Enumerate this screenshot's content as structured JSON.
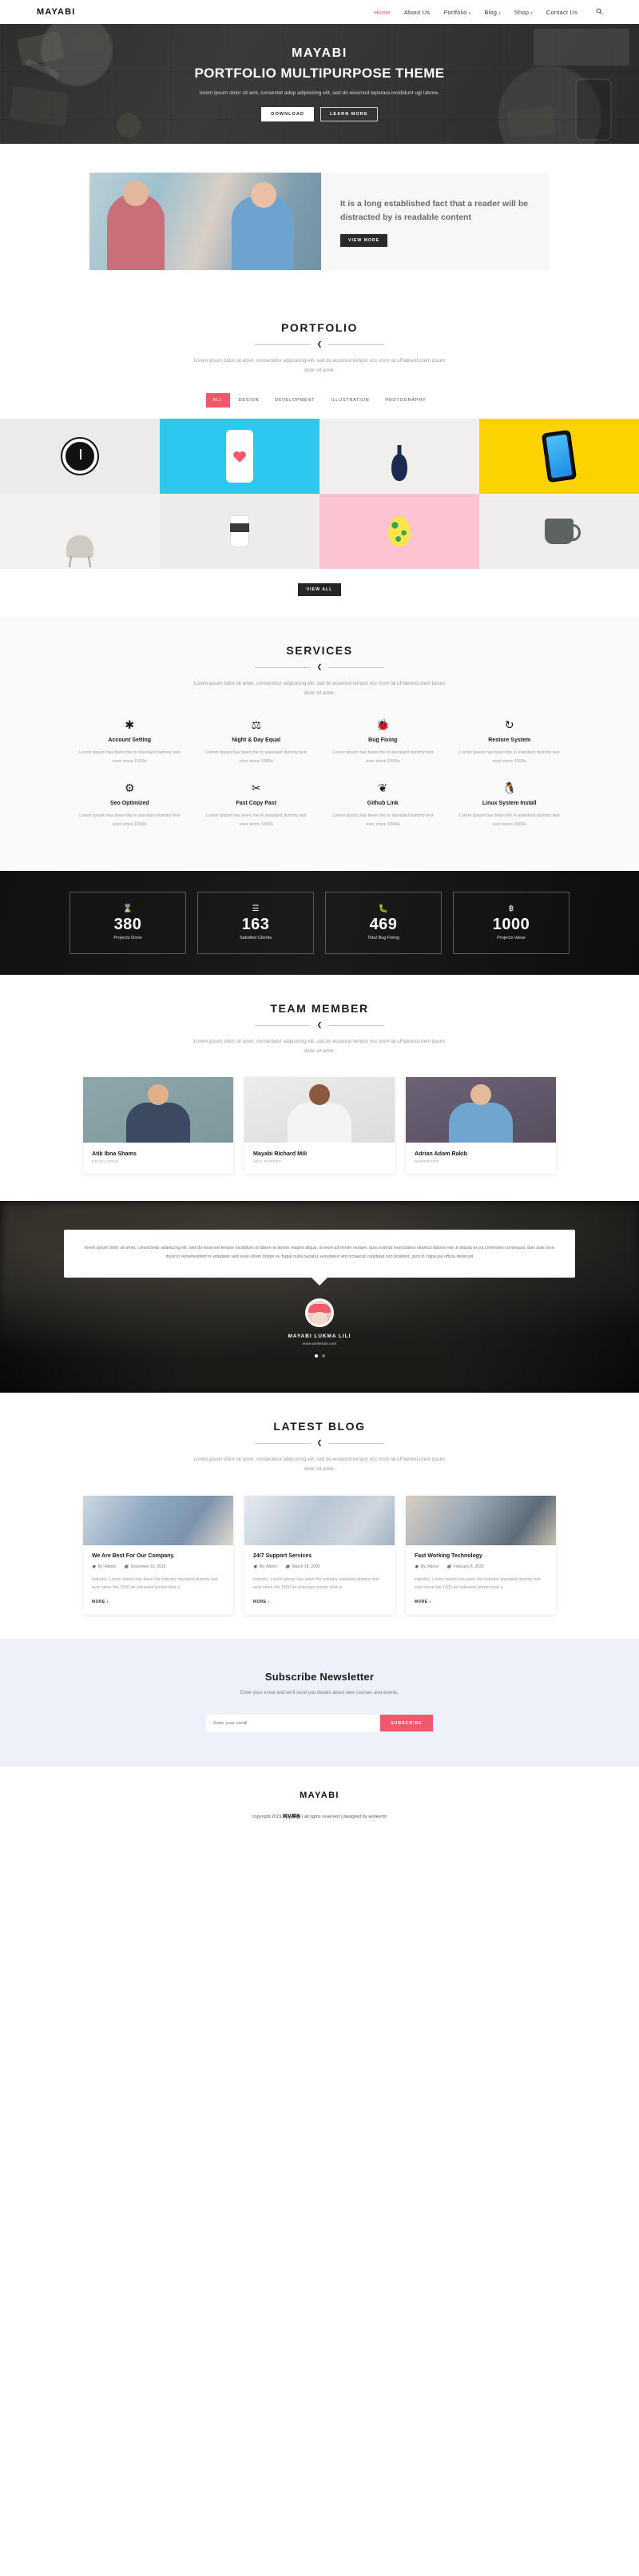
{
  "nav": {
    "brand": "MAYABI",
    "links": [
      {
        "label": "Home",
        "caret": false,
        "active": true
      },
      {
        "label": "About Us",
        "caret": false,
        "active": false
      },
      {
        "label": "Portfolio",
        "caret": true,
        "active": false
      },
      {
        "label": "Blog",
        "caret": true,
        "active": false
      },
      {
        "label": "Shop",
        "caret": true,
        "active": false
      },
      {
        "label": "Contact Us",
        "caret": false,
        "active": false
      }
    ],
    "search_icon": "⌕"
  },
  "hero": {
    "title": "MAYABI",
    "subtitle": "PORTFOLIO MULTIPURPOSE THEME",
    "description": "lorem ipsum dolor sit amt, consectet adop adipisicing elit, sed do eiusmod teporara incididunt ugt labore.",
    "primary_button": "DOWNLOAD",
    "secondary_button": "LEARN MORE"
  },
  "about": {
    "heading": "It is a long established fact that a reader will be distracted by is readable content",
    "button": "VIEW MORE"
  },
  "portfolio": {
    "title": "PORTFOLIO",
    "divider_icon": "❮",
    "description": "Lorem ipsum dolor sit amet, consectetur adipisicing elit, sed do eiusmod tempor ncc msm lal uFlaboreLorem ipsum dolor sit amet,",
    "filters": [
      {
        "label": "ALL",
        "active": true
      },
      {
        "label": "DESIGN",
        "active": false
      },
      {
        "label": "DEVELOPMENT",
        "active": false
      },
      {
        "label": "ILLUSTRATION",
        "active": false
      },
      {
        "label": "PHOTOGRAPHY",
        "active": false
      }
    ],
    "view_all": "VIEW ALL"
  },
  "services": {
    "title": "SERVICES",
    "divider_icon": "❮",
    "description": "Lorem ipsum dolor sit amet, consectetur adipisicing elit, sed do eiusmod tempor ncc msm lal uFlaboreLorem ipsum dolor sit amet,",
    "items": [
      {
        "icon": "✳",
        "title": "Account Setting",
        "desc": "Lorem Ipsum has been the in standard dummy text ever since 1500s"
      },
      {
        "icon": "⚖",
        "title": "Night & Day Equal",
        "desc": "Lorem Ipsum has been the in standard dummy text ever since 1500s"
      },
      {
        "icon": "ὁE",
        "title": "Bug Fixing",
        "desc": "Lorem Ipsum has been the in standard dummy text ever since 1500s"
      },
      {
        "icon": "↻",
        "title": "Restore System",
        "desc": "Lorem Ipsum has been the in standard dummy text ever since 1500s"
      },
      {
        "icon": "⚙",
        "title": "Seo Optimized",
        "desc": "Lorem Ipsum has been the in standard dummy text ever since 1500s"
      },
      {
        "icon": "✂",
        "title": "Fast Copy Past",
        "desc": "Lorem Ipsum has been the in standard dummy text ever since 1500s"
      },
      {
        "icon": "❦",
        "title": "Github Link",
        "desc": "Lorem Ipsum has been the in standard dummy text ever since 1500s"
      },
      {
        "icon": "ὂ7",
        "title": "Linux System Install",
        "desc": "Lorem Ipsum has been the in standard dummy text ever since 1500s"
      }
    ]
  },
  "counters": [
    {
      "icon": "⌛",
      "value": "380",
      "label": "Projects Done"
    },
    {
      "icon": "☰",
      "value": "163",
      "label": "Satisfied Clients"
    },
    {
      "icon": "ὁB",
      "value": "469",
      "label": "Total Bug Fixing"
    },
    {
      "icon": "฿",
      "value": "1000",
      "label": "Projects Value"
    }
  ],
  "team": {
    "title": "TEAM MEMBER",
    "divider_icon": "❮",
    "description": "Lorem ipsum dolor sit amet, consectetur adipisicing elit, sed do eiusmod tempor ncc msm lal uFlaboreLorem ipsum dolor sit amet,",
    "members": [
      {
        "name": "Atik Ibna Shams",
        "role": "DEVELOPER"
      },
      {
        "name": "Mayabi Richard Mili",
        "role": "SEO EXPERT"
      },
      {
        "name": "Adrian Adam Rakib",
        "role": "MARKETER"
      }
    ]
  },
  "testimonial": {
    "quote": "lorem ipsum dolor sit amet, consectetur adipiscing elit, sed do eiusmod tempor incididunt ut labore et dolore magna aliqua. ut enim ad minim veniam, quis nostrud exercitation ullamco laboris nisi ut aliquip ex ea commodo consequat. duis aute irure dolor in reprehenderit in voluptate velit esse cillum dolore eu fugiat nulla pariatur. excepteur sint occaecat cupidatat non proident, sunt in culpa qui officia deserunt",
    "name": "MAYABI LUKMA LILI",
    "url": "www.workentm.com",
    "dots": 2,
    "active_dot": 0
  },
  "blog": {
    "title": "LATEST BLOG",
    "divider_icon": "❮",
    "description": "Lorem ipsum dolor sit amet, consectetur adipisicing elit, sed do eiusmod tempor ncc msm lal uFlaboreLorem ipsum dolor sit amet,",
    "posts": [
      {
        "title": "We Are Best For Our Company.",
        "author": "By: Admin",
        "date": "December 10, 2019",
        "excerpt": "industry. Lorem Ipsum has been the industry standard dummy text ever since the 1500 an unknown printer took a",
        "more": "MORE ›"
      },
      {
        "title": "24/7 Support Services",
        "author": "By: Admin",
        "date": "March 18, 2000",
        "excerpt": "industry. Lorem Ipsum has been the industry standard dummy text ever since the 1500 an unknown printer took a",
        "more": "MORE ›"
      },
      {
        "title": "Fast Working Technology",
        "author": "By: Admin",
        "date": "February 8, 2030",
        "excerpt": "industry. Lorem Ipsum has been the industry standard dummy text ever since the 1500 an unknown printer took a",
        "more": "MORE ›"
      }
    ],
    "author_icon": "◉",
    "date_icon": "Ὄ5"
  },
  "newsletter": {
    "title": "Subscribe Newsletter",
    "description": "Enter your email and we'll send you details about new courses and events.",
    "placeholder": "Enter your email",
    "button": "SUBSCRIBE"
  },
  "footer": {
    "brand": "MAYABI",
    "copyright_prefix": "copyright 2019 ",
    "copyright_brand": "网站模板",
    "copyright_suffix": " | all rights reserved | designed by workertm"
  },
  "colors": {
    "accent": "#f4566a",
    "dark": "#1b1b1b",
    "newsletter_bg": "#eef1f8"
  }
}
